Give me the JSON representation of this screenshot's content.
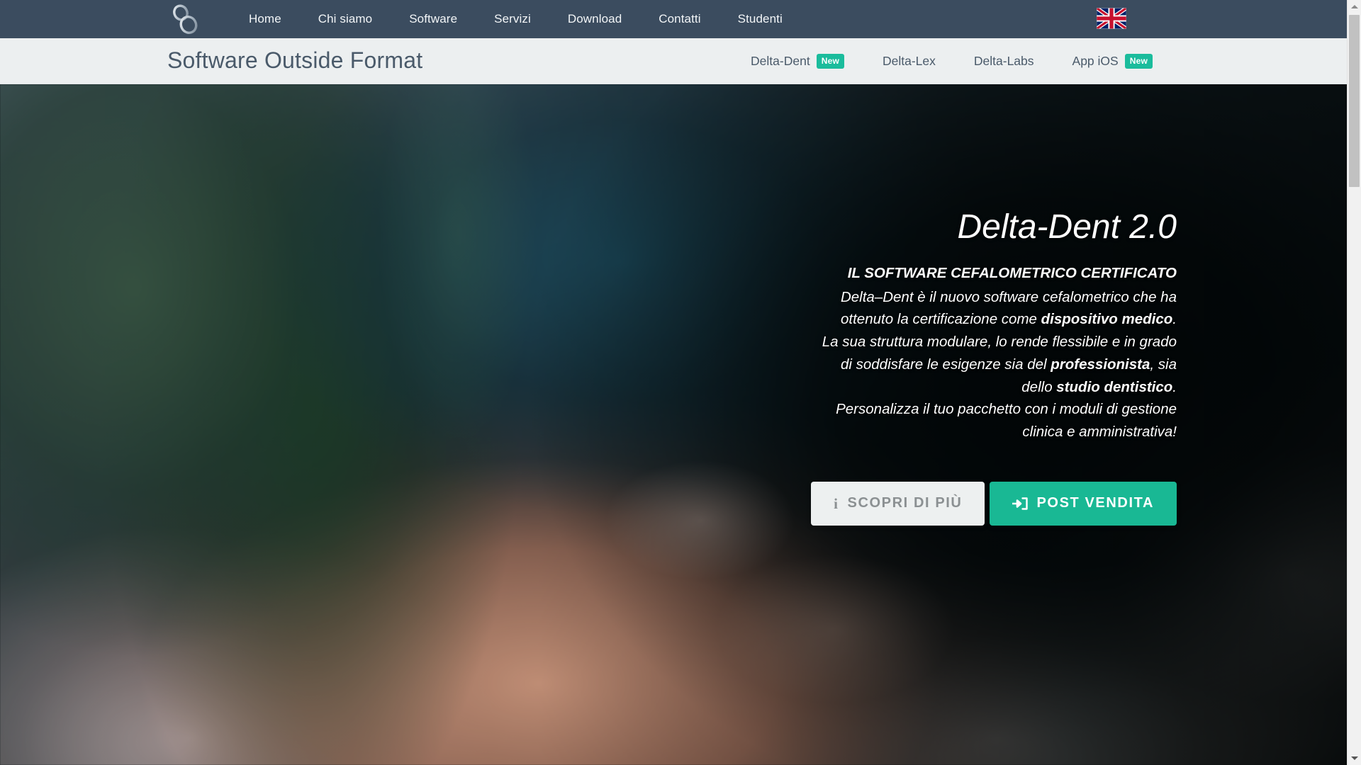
{
  "topbar": {
    "logo_icon": "infinity-loop-logo",
    "nav_items": [
      {
        "label": "Home"
      },
      {
        "label": "Chi siamo"
      },
      {
        "label": "Software"
      },
      {
        "label": "Servizi"
      },
      {
        "label": "Download"
      },
      {
        "label": "Contatti"
      },
      {
        "label": "Studenti"
      }
    ],
    "language_flag": "uk-flag-icon",
    "background_color": "#3b4c5f"
  },
  "brandbar": {
    "title": "Software Outside Format",
    "background_color": "#eceff0",
    "products": [
      {
        "label": "Delta-Dent",
        "badge": "New"
      },
      {
        "label": "Delta-Lex",
        "badge": ""
      },
      {
        "label": "Delta-Labs",
        "badge": ""
      },
      {
        "label": "App iOS",
        "badge": "New"
      }
    ],
    "badge_color": "#1abc9c"
  },
  "hero": {
    "title": "Delta-Dent 2.0",
    "lead": "IL SOFTWARE CEFALOMETRICO CERTIFICATO",
    "paragraph": {
      "line1_pre": "Delta–Dent è il nuovo software cefalometrico che ha",
      "line2_pre": "ottenuto la certificazione come ",
      "line2_bold": "dispositivo medico",
      "line2_post": ".",
      "line3": "La sua struttura modulare, lo rende flessibile e in grado",
      "line4_pre": "di soddisfare le esigenze sia del ",
      "line4_bold": "professionista",
      "line4_post": ", sia",
      "line5_pre": "dello ",
      "line5_bold": "studio dentistico",
      "line5_post": ".",
      "line6": "Personalizza il tuo pacchetto con i moduli di gestione",
      "line7": "clinica e amministrativa!"
    },
    "buttons": {
      "secondary": {
        "label": "SCOPRI DI PIÙ",
        "icon": "info-icon",
        "color": "#edf0f0"
      },
      "primary": {
        "label": "POST VENDITA",
        "icon": "sign-in-icon",
        "color": "#19b894"
      }
    }
  },
  "scrollbar": {
    "up_arrow": "scroll-up-arrow",
    "down_arrow": "scroll-down-arrow"
  }
}
